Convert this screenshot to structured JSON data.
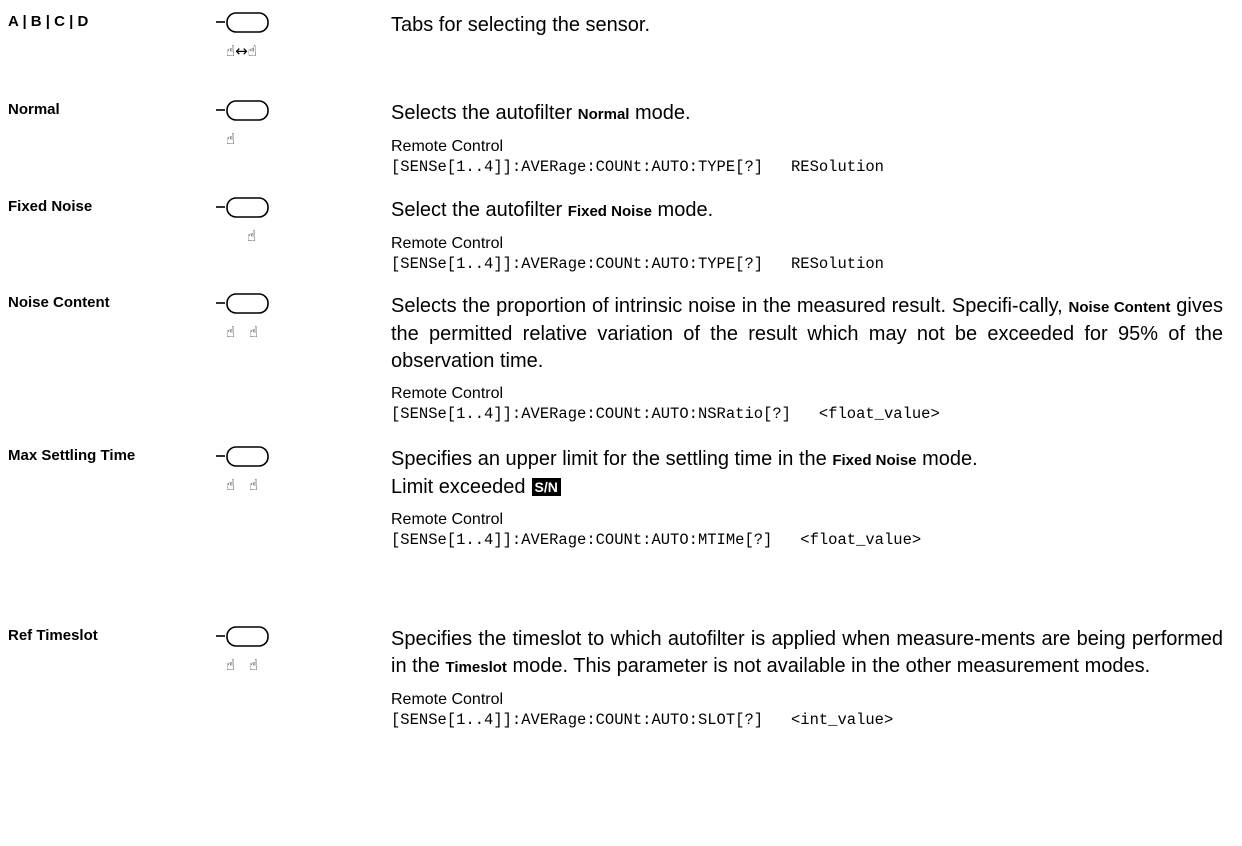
{
  "entries": [
    {
      "label": "A | B | C | D",
      "icon": "softkey-hand-left-right",
      "text": "Tabs for selecting the sensor."
    },
    {
      "label": "Normal",
      "icon": "softkey-hand",
      "text_pre": "Selects the autofilter ",
      "text_bold": "Normal",
      "text_post": " mode.",
      "remote_label": "Remote Control",
      "remote_cmd": "[SENSe[1..4]]:AVERage:COUNt:AUTO:TYPE[?]   RESolution"
    },
    {
      "label": "Fixed Noise",
      "icon": "softkey-hand-right",
      "text_pre": "Select the autofilter ",
      "text_bold": "Fixed Noise",
      "text_post": " mode.",
      "remote_label": "Remote Control",
      "remote_cmd": "[SENSe[1..4]]:AVERage:COUNt:AUTO:TYPE[?]   RESolution"
    },
    {
      "label": "Noise Content",
      "icon": "softkey-two-hands",
      "text_pre": "Selects the proportion of intrinsic noise in the measured result. Specifi-cally, ",
      "text_bold": "Noise Content",
      "text_post": " gives the permitted relative variation of the result which may not be exceeded for 95% of the observation time.",
      "remote_label": "Remote Control",
      "remote_cmd": "[SENSe[1..4]]:AVERage:COUNt:AUTO:NSRatio[?]   <float_value>"
    },
    {
      "label": "Max Settling Time",
      "icon": "softkey-two-hands",
      "text_pre": "Specifies an upper limit for the settling time in the ",
      "text_bold": "Fixed Noise",
      "text_post": " mode.",
      "text_line2": "Limit exceeded",
      "badge": "S/N",
      "remote_label": "Remote Control",
      "remote_cmd": "[SENSe[1..4]]:AVERage:COUNt:AUTO:MTIMe[?]   <float_value>"
    },
    {
      "label": "Ref Timeslot",
      "icon": "softkey-two-hands",
      "text_pre": "Specifies the timeslot to which autofilter is applied when measure-ments are being performed in the ",
      "text_bold": "Timeslot",
      "text_post": " mode. This parameter is not available in the other measurement modes.",
      "remote_label": "Remote Control",
      "remote_cmd": "[SENSe[1..4]]:AVERage:COUNt:AUTO:SLOT[?]   <int_value>"
    }
  ]
}
